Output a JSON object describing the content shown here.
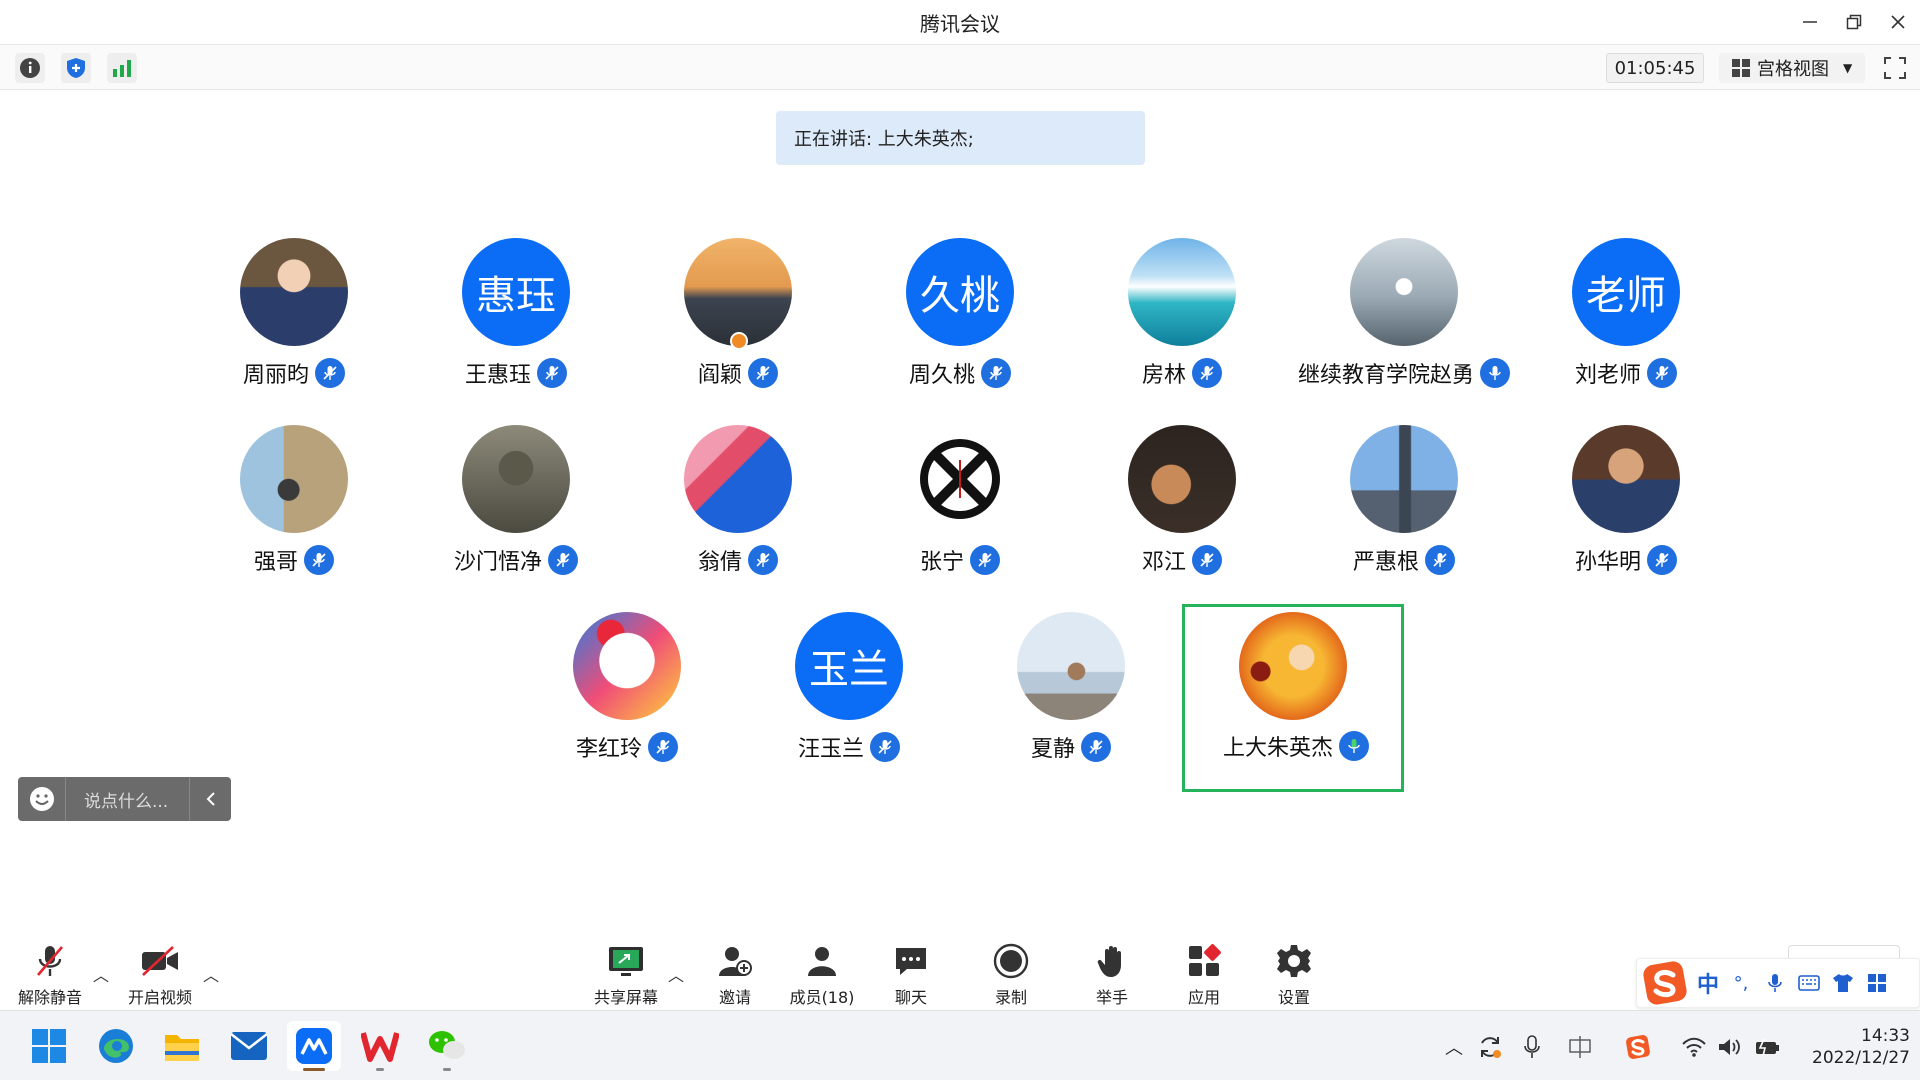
{
  "window": {
    "title": "腾讯会议"
  },
  "toolbar": {
    "timer": "01:05:45",
    "view_mode": "宫格视图"
  },
  "speaking_banner": "正在讲话: 上大朱英杰;",
  "participants": [
    {
      "name": "周丽昀",
      "avatar_text": ""
    },
    {
      "name": "王惠珏",
      "avatar_text": "惠珏"
    },
    {
      "name": "阎颖",
      "avatar_text": ""
    },
    {
      "name": "周久桃",
      "avatar_text": "久桃"
    },
    {
      "name": "房林",
      "avatar_text": ""
    },
    {
      "name": "继续教育学院赵勇",
      "avatar_text": ""
    },
    {
      "name": "刘老师",
      "avatar_text": "老师"
    },
    {
      "name": "强哥",
      "avatar_text": ""
    },
    {
      "name": "沙门悟净",
      "avatar_text": ""
    },
    {
      "name": "翁倩",
      "avatar_text": ""
    },
    {
      "name": "张宁",
      "avatar_text": ""
    },
    {
      "name": "邓江",
      "avatar_text": ""
    },
    {
      "name": "严惠根",
      "avatar_text": ""
    },
    {
      "name": "孙华明",
      "avatar_text": ""
    },
    {
      "name": "李红玲",
      "avatar_text": ""
    },
    {
      "name": "汪玉兰",
      "avatar_text": "玉兰"
    },
    {
      "name": "夏静",
      "avatar_text": ""
    },
    {
      "name": "上大朱英杰",
      "avatar_text": ""
    }
  ],
  "chat": {
    "placeholder": "说点什么..."
  },
  "meeting_bar": {
    "unmute": "解除静音",
    "start_video": "开启视频",
    "share_screen": "共享屏幕",
    "invite": "邀请",
    "members": "成员(18)",
    "chat": "聊天",
    "record": "录制",
    "raise_hand": "举手",
    "apps": "应用",
    "settings": "设置"
  },
  "ime": {
    "lang": "中"
  },
  "taskbar": {
    "time": "14:33",
    "date": "2022/12/27"
  },
  "colors": {
    "accent_blue": "#0b6cf5",
    "active_speaker_border": "#25b35b",
    "speaking_banner_bg": "#dceafa"
  }
}
